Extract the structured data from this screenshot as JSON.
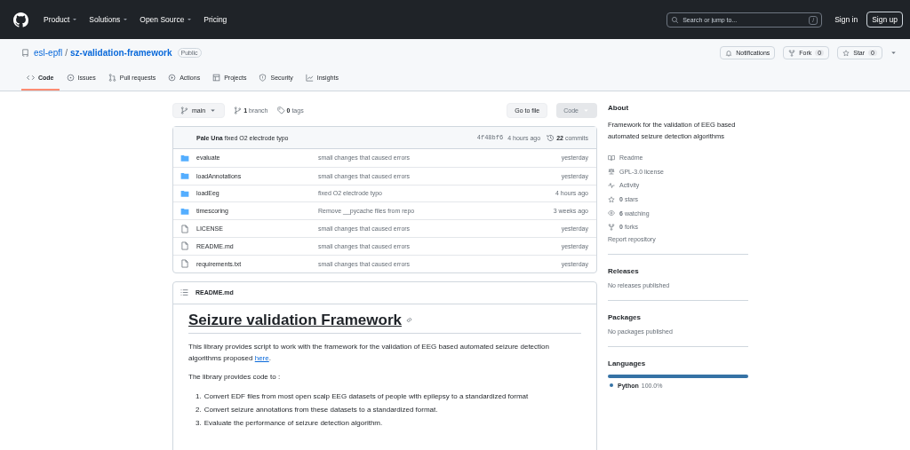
{
  "header": {
    "nav": [
      {
        "label": "Product",
        "caret": true
      },
      {
        "label": "Solutions",
        "caret": true
      },
      {
        "label": "Open Source",
        "caret": true
      },
      {
        "label": "Pricing",
        "caret": false
      }
    ],
    "search": {
      "placeholder": "Search or jump to...",
      "key": "/"
    },
    "sign_in": "Sign in",
    "sign_up": "Sign up"
  },
  "repo": {
    "owner": "esl-epfl",
    "separator": "/",
    "name": "sz-validation-framework",
    "visibility": "Public",
    "actions": [
      {
        "kind": "bell",
        "label": "Notifications"
      },
      {
        "kind": "fork",
        "label": "Fork",
        "count": "0"
      },
      {
        "kind": "star",
        "label": "Star",
        "count": "0"
      }
    ],
    "tabs": [
      {
        "kind": "code",
        "label": "Code",
        "selected": true
      },
      {
        "kind": "issue",
        "label": "Issues",
        "selected": false
      },
      {
        "kind": "pull",
        "label": "Pull requests",
        "selected": false
      },
      {
        "kind": "play",
        "label": "Actions",
        "selected": false
      },
      {
        "kind": "table",
        "label": "Projects",
        "selected": false
      },
      {
        "kind": "shield",
        "label": "Security",
        "selected": false
      },
      {
        "kind": "graph",
        "label": "Insights",
        "selected": false
      }
    ]
  },
  "toolbar": {
    "branch": "main",
    "branch_count": "1",
    "branch_label": "branch",
    "tag_count": "0",
    "tag_label": "tags",
    "go_to_file": "Go to file",
    "code_button": {
      "label": "Code",
      "disabled": true
    }
  },
  "commit": {
    "author": "Pale Una",
    "message": "fixed O2 electrode typo",
    "hash": "4f48bf6",
    "time": "4 hours ago",
    "count": "22",
    "count_label": "commits"
  },
  "files": [
    {
      "kind": "folder",
      "name": "evaluate",
      "message": "small changes that caused errors",
      "time": "yesterday"
    },
    {
      "kind": "folder",
      "name": "loadAnnotations",
      "message": "small changes that caused errors",
      "time": "yesterday"
    },
    {
      "kind": "folder",
      "name": "loadEeg",
      "message": "fixed O2 electrode typo",
      "time": "4 hours ago"
    },
    {
      "kind": "folder",
      "name": "timescoring",
      "message": "Remove __pycache files from repo",
      "time": "3 weeks ago"
    },
    {
      "kind": "file",
      "name": "LICENSE",
      "message": "small changes that caused errors",
      "time": "yesterday"
    },
    {
      "kind": "file",
      "name": "README.md",
      "message": "small changes that caused errors",
      "time": "yesterday"
    },
    {
      "kind": "file",
      "name": "requirements.txt",
      "message": "small changes that caused errors",
      "time": "yesterday"
    }
  ],
  "readme": {
    "filename": "README.md",
    "title": "Seizure validation Framework",
    "intro": {
      "before": "This library provides script to work with the framework for the validation of EEG based automated seizure detection algorithms proposed ",
      "link": "here",
      "after": "."
    },
    "lead": "The library provides code to :",
    "steps": [
      {
        "number": "1.",
        "text": "Convert EDF files from most open scalp EEG datasets of people with epilepsy to a standardized format"
      },
      {
        "number": "2.",
        "text": "Convert seizure annotations from these datasets to a standardized format."
      },
      {
        "number": "3.",
        "text": "Evaluate the performance of seizure detection algorithm."
      }
    ]
  },
  "sidebar": {
    "about": {
      "title": "About",
      "description": "Framework for the validation of EEG based automated seizure detection algorithms",
      "links": [
        {
          "kind": "book",
          "label": "Readme"
        },
        {
          "kind": "scale",
          "label": "GPL-3.0 license"
        },
        {
          "kind": "pulse",
          "label": "Activity"
        },
        {
          "kind": "star",
          "count": "0",
          "label": "stars"
        },
        {
          "kind": "eye",
          "count": "6",
          "label": "watching"
        },
        {
          "kind": "fork",
          "count": "0",
          "label": "forks"
        }
      ],
      "report": "Report repository"
    },
    "releases": {
      "title": "Releases",
      "note": "No releases published"
    },
    "packages": {
      "title": "Packages",
      "note": "No packages published"
    },
    "languages": {
      "title": "Languages",
      "items": [
        {
          "name": "Python",
          "percent": "100.0%",
          "color": "#3572a5",
          "level": 1.0
        }
      ]
    }
  }
}
